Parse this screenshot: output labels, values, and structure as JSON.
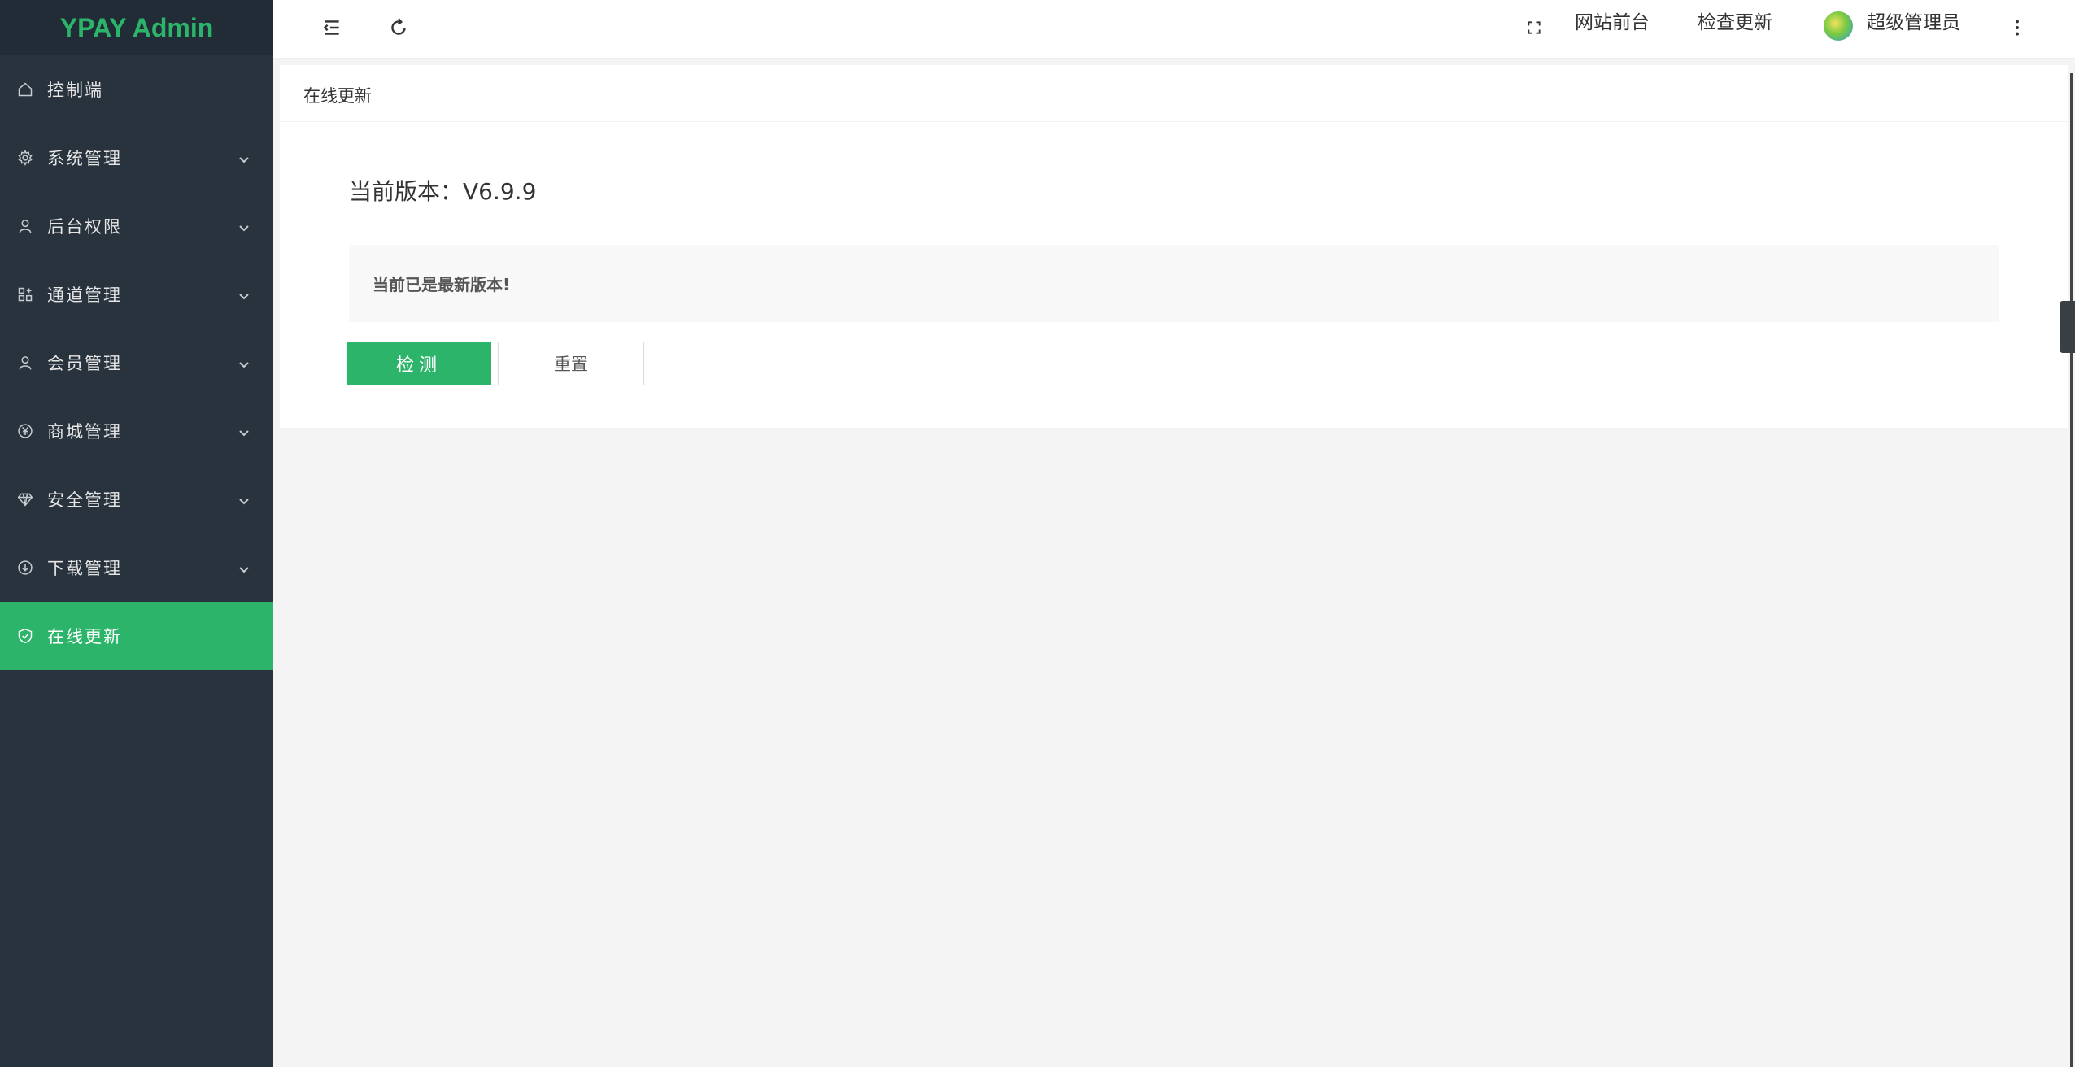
{
  "app": {
    "logo_text": "YPAY Admin"
  },
  "sidebar": {
    "items": [
      {
        "label": "控制端",
        "icon": "home-icon",
        "has_submenu": false,
        "active": false
      },
      {
        "label": "系统管理",
        "icon": "gear-icon",
        "has_submenu": true,
        "active": false
      },
      {
        "label": "后台权限",
        "icon": "user-icon",
        "has_submenu": true,
        "active": false
      },
      {
        "label": "通道管理",
        "icon": "apps-icon",
        "has_submenu": true,
        "active": false
      },
      {
        "label": "会员管理",
        "icon": "user-icon",
        "has_submenu": true,
        "active": false
      },
      {
        "label": "商城管理",
        "icon": "yen-icon",
        "has_submenu": true,
        "active": false
      },
      {
        "label": "安全管理",
        "icon": "diamond-icon",
        "has_submenu": true,
        "active": false
      },
      {
        "label": "下载管理",
        "icon": "download-icon",
        "has_submenu": true,
        "active": false
      },
      {
        "label": "在线更新",
        "icon": "shield-check-icon",
        "has_submenu": false,
        "active": true
      }
    ]
  },
  "header": {
    "menu_toggle_icon": "collapse-menu-icon",
    "refresh_icon": "refresh-icon",
    "fullscreen_icon": "fullscreen-icon",
    "site_front_label": "网站前台",
    "check_update_label": "检查更新",
    "username": "超级管理员",
    "more_icon": "more-vertical-icon"
  },
  "main": {
    "card_title": "在线更新",
    "version_text": "当前版本：V6.9.9",
    "notice_text": "当前已是最新版本!",
    "detect_button": "检测",
    "reset_button": "重置"
  },
  "colors": {
    "accent": "#2cb56a",
    "sidebar_bg": "#28333e",
    "page_bg": "#f4f4f4"
  }
}
